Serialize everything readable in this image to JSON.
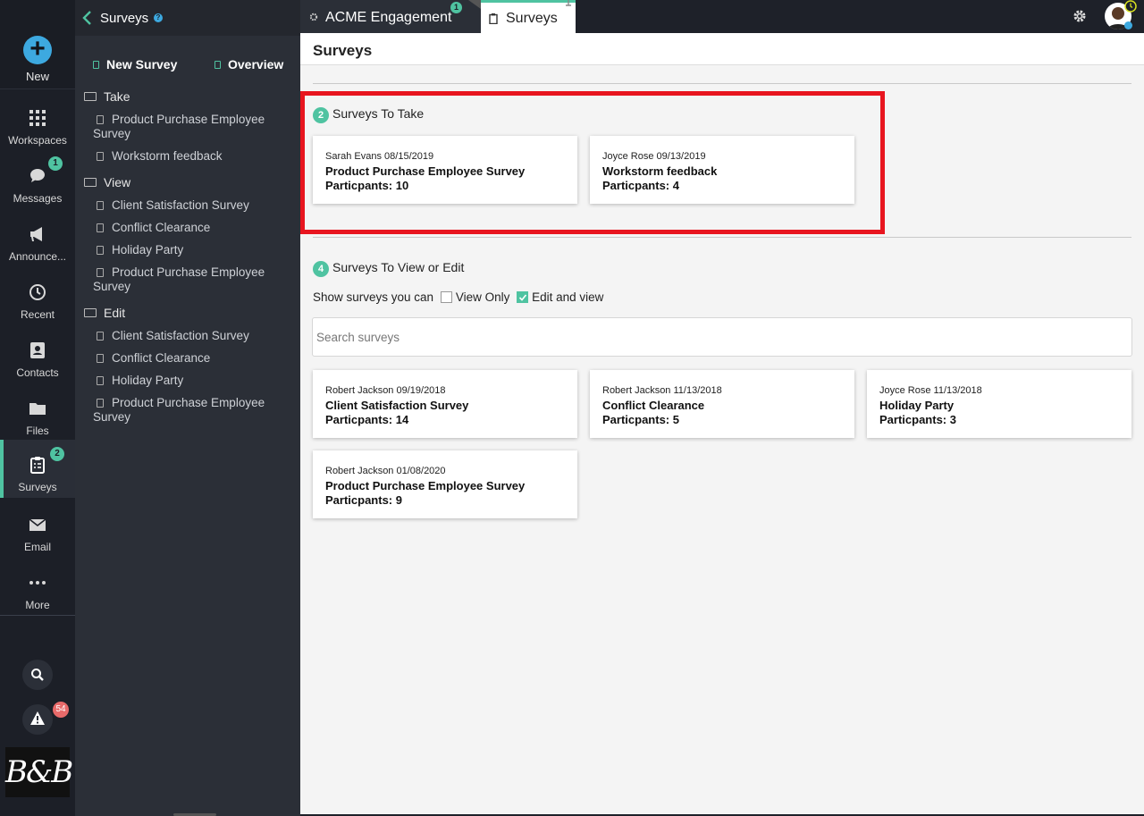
{
  "rail": {
    "new_label": "New",
    "items": [
      {
        "label": "Workspaces",
        "icon": "grid-icon"
      },
      {
        "label": "Messages",
        "icon": "chat-icon",
        "badge": "1"
      },
      {
        "label": "Announce...",
        "icon": "megaphone-icon"
      },
      {
        "label": "Recent",
        "icon": "history-icon"
      },
      {
        "label": "Contacts",
        "icon": "contacts-icon"
      },
      {
        "label": "Files",
        "icon": "folder-icon"
      },
      {
        "label": "Surveys",
        "icon": "clipboard-icon",
        "badge": "2",
        "active": true
      },
      {
        "label": "Email",
        "icon": "envelope-icon"
      },
      {
        "label": "More",
        "icon": "more-icon"
      }
    ],
    "alerts_badge": "54",
    "logo_text": "B&B"
  },
  "nav": {
    "title": "Surveys",
    "new_survey": "New Survey",
    "overview": "Overview",
    "groups": [
      {
        "label": "Take",
        "items": [
          "Product Purchase Employee Survey",
          "Workstorm feedback"
        ]
      },
      {
        "label": "View",
        "items": [
          "Client Satisfaction Survey",
          "Conflict Clearance",
          "Holiday Party",
          "Product Purchase Employee Survey"
        ]
      },
      {
        "label": "Edit",
        "items": [
          "Client Satisfaction Survey",
          "Conflict Clearance",
          "Holiday Party",
          "Product Purchase Employee Survey"
        ]
      }
    ]
  },
  "tabs": {
    "tab1": {
      "label": "ACME Engagement",
      "badge": "1"
    },
    "tab2": {
      "label": "Surveys"
    }
  },
  "main": {
    "title": "Surveys",
    "take": {
      "count": "2",
      "title": "Surveys To Take",
      "cards": [
        {
          "meta": "Sarah Evans 08/15/2019",
          "name": "Product Purchase Employee Survey",
          "participants": "Particpants: 10"
        },
        {
          "meta": "Joyce Rose 09/13/2019",
          "name": "Workstorm feedback",
          "participants": "Particpants: 4"
        }
      ]
    },
    "view": {
      "count": "4",
      "title": "Surveys To View or Edit",
      "filter_label": "Show surveys you can",
      "view_only": "View Only",
      "edit_and_view": "Edit and view",
      "search_placeholder": "Search surveys",
      "cards": [
        {
          "meta": "Robert Jackson 09/19/2018",
          "name": "Client Satisfaction Survey",
          "participants": "Particpants: 14"
        },
        {
          "meta": "Robert Jackson 11/13/2018",
          "name": "Conflict Clearance",
          "participants": "Particpants: 5"
        },
        {
          "meta": "Joyce Rose 11/13/2018",
          "name": "Holiday Party",
          "participants": "Particpants: 3"
        },
        {
          "meta": "Robert Jackson 01/08/2020",
          "name": "Product Purchase Employee Survey",
          "participants": "Particpants: 9"
        }
      ]
    }
  },
  "colors": {
    "accent": "#4fc3a1",
    "highlight": "#e8151f",
    "brand_blue": "#3da9e0"
  }
}
